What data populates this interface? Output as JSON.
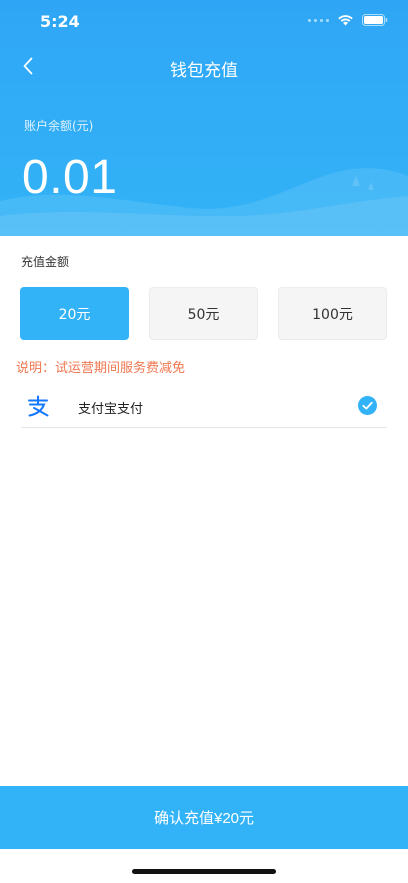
{
  "status_bar": {
    "time": "5:24"
  },
  "nav": {
    "title": "钱包充值",
    "back_icon": "chevron-left-icon"
  },
  "balance": {
    "label": "账户余额(元)",
    "value": "0.01"
  },
  "recharge": {
    "section_label": "充值金额",
    "options": [
      {
        "label": "20元",
        "selected": true
      },
      {
        "label": "50元",
        "selected": false
      },
      {
        "label": "100元",
        "selected": false
      }
    ],
    "notice": "说明：试运营期间服务费减免"
  },
  "payment": {
    "label": "支付宝支付",
    "icon": "alipay-icon",
    "selected": true
  },
  "confirm": {
    "label": "确认充值¥20元"
  },
  "colors": {
    "primary": "#33b3f7",
    "notice": "#f0774f",
    "option_bg": "#f5f5f5"
  }
}
